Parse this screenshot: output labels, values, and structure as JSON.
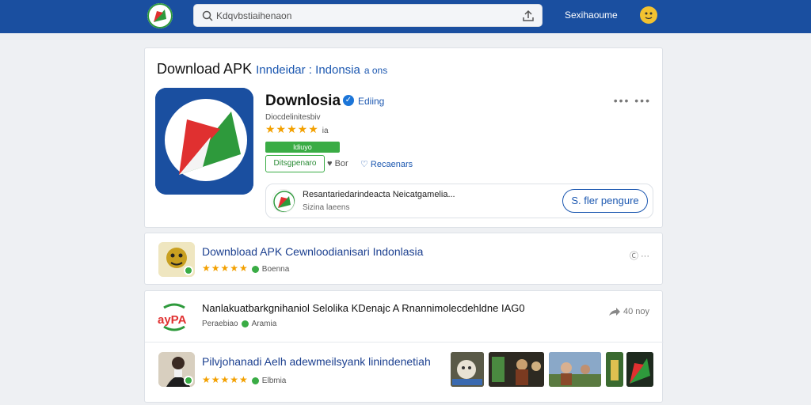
{
  "header": {
    "search_placeholder": "Kdqvbstiaihenaon",
    "user_label": "Sexihaoume"
  },
  "main": {
    "title": "Download APK",
    "title_accent": "Inndeidar : Indonsia",
    "title_tail": "a ons",
    "app_name": "Downlosia",
    "verified_label": "Ediing",
    "developer": "Diocdelinitesbiv",
    "rating_count": "ia",
    "install_label": "ldiuyo",
    "download_button": "Ditsgpenaro",
    "action_1": "Bor",
    "action_2": "Recaenars",
    "publisher": {
      "name": "Resantariedarindeacta Neicatgamelia...",
      "subtitle": "Sizina laeens",
      "follow_button": "S. fler pengure"
    }
  },
  "results": [
    {
      "title": "Downbload APK Cewnloodianisari Indonlasia",
      "stars": "★★★★★",
      "meta": "Boenna",
      "right": "Ⓒ ···"
    },
    {
      "title": "Nanlakuatbarkgnihaniol Selolika KDenajc A Rnannimolecdehldne IAG0",
      "prefix": "Peraebiao",
      "meta": "Aramia",
      "right": "40 noy"
    },
    {
      "title": "Pilvjohanadi Aelh adewmeilsyank linindenetiah",
      "stars": "★★★★★",
      "meta": "Elbmia"
    }
  ],
  "colors": {
    "topbar": "#1a4fa0",
    "accent": "#1b57b0",
    "green": "#3aac45",
    "star": "#f3a000"
  }
}
